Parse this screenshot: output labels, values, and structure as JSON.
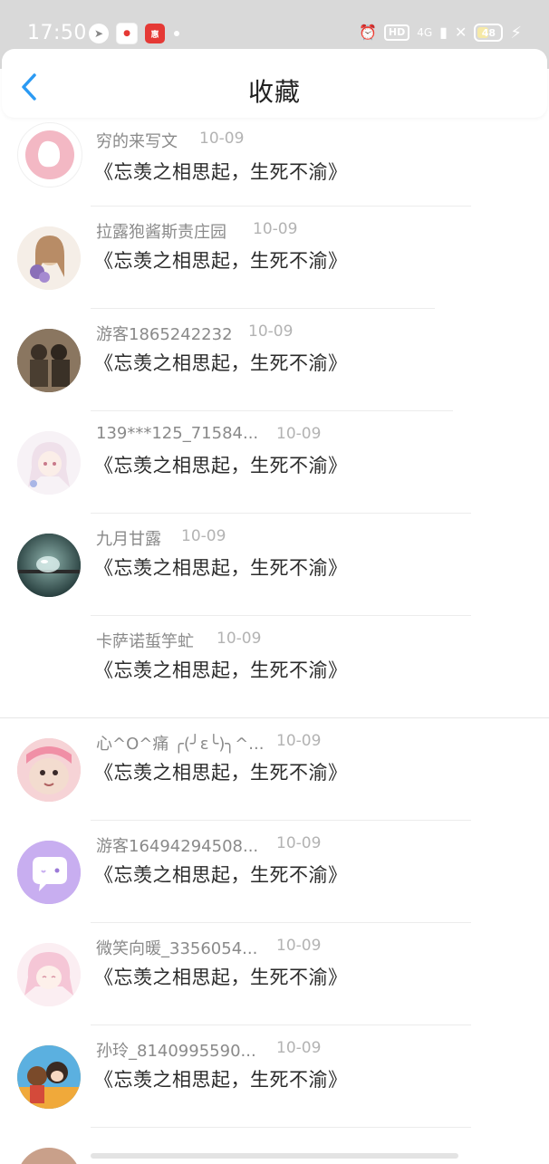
{
  "status_bar": {
    "time": "17:50",
    "network": "4G",
    "battery": "48",
    "hd": "HD"
  },
  "header": {
    "title": "收藏"
  },
  "favorites": [
    {
      "user": "穷的来写文",
      "date": "10-09",
      "title": "《忘羡之相思起，生死不渝》",
      "avatar_color": "#f3b8c4"
    },
    {
      "user": "拉露狍酱斯责庄园",
      "date": "10-09",
      "title": "《忘羡之相思起，生死不渝》",
      "avatar_color": "#e9d6c6"
    },
    {
      "user": "游客1865242232",
      "date": "10-09",
      "title": "《忘羡之相思起，生死不渝》",
      "avatar_color": "#6b5a48"
    },
    {
      "user": "139***125_71584...",
      "date": "10-09",
      "title": "《忘羡之相思起，生死不渝》",
      "avatar_color": "#efe6ef"
    },
    {
      "user": "九月甘露",
      "date": "10-09",
      "title": "《忘羡之相思起，生死不渝》",
      "avatar_color": "#3c5a5a"
    },
    {
      "user": "卡萨诺蜇竽虻",
      "date": "10-09",
      "title": "《忘羡之相思起，生死不渝》",
      "avatar_color": "#ffffff"
    },
    {
      "user": "心^O^痛 ╭(╯ε╰)╮^...",
      "date": "10-09",
      "title": "《忘羡之相思起，生死不渝》",
      "avatar_color": "#f2c1c6"
    },
    {
      "user": "游客16494294508...",
      "date": "10-09",
      "title": "《忘羡之相思起，生死不渝》",
      "avatar_color": "#c8aef0"
    },
    {
      "user": "微笑向暖_3356054...",
      "date": "10-09",
      "title": "《忘羡之相思起，生死不渝》",
      "avatar_color": "#f7dde4"
    },
    {
      "user": "孙玲_8140995590...",
      "date": "10-09",
      "title": "《忘羡之相思起，生死不渝》",
      "avatar_color": "#f0a93a"
    }
  ],
  "colors": {
    "accent": "#2b9af3",
    "status_bar": "#d9d9d9"
  }
}
